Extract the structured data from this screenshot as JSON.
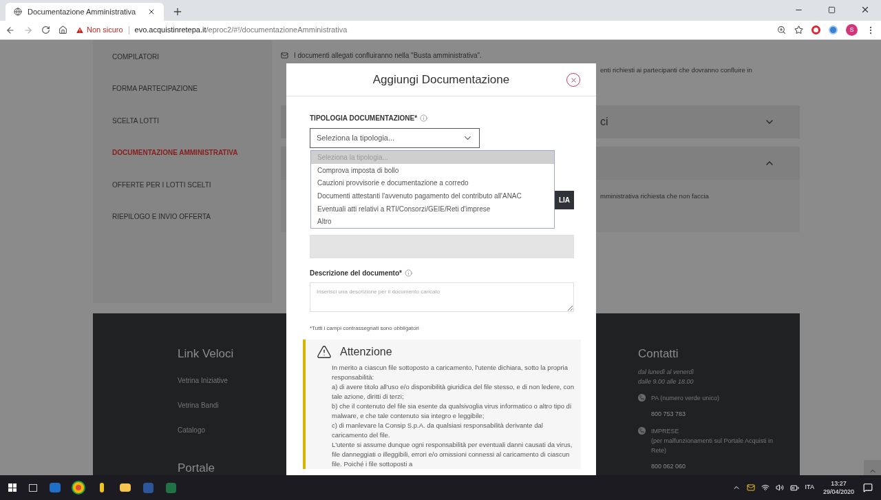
{
  "browser": {
    "tab_title": "Documentazione Amministrativa",
    "security": "Non sicuro",
    "url_domain": "evo.acquistinretepa.it",
    "url_path": "/eproc2/#!/documentazioneAmministrativa",
    "profile_initial": "S"
  },
  "sidebar": {
    "items": [
      {
        "label": "COMPILATORI",
        "selected": false
      },
      {
        "label": "FORMA PARTECIPAZIONE",
        "selected": false
      },
      {
        "label": "SCELTA LOTTI",
        "selected": false
      },
      {
        "label": "DOCUMENTAZIONE AMMINISTRATIVA",
        "selected": true
      },
      {
        "label": "OFFERTE PER I LOTTI SCELTI",
        "selected": false
      },
      {
        "label": "RIEPILOGO E INVIO OFFERTA",
        "selected": false
      }
    ]
  },
  "page": {
    "notice": "I documenti allegati confluiranno nella \"Busta amministrativa\".",
    "intro_fragment": "enti richiesti ai partecipanti che dovranno confluire in",
    "accordions": [
      {
        "title": "ci",
        "expanded": false
      },
      {
        "expanded": true,
        "body": "mministrativa richiesta che non faccia"
      }
    ]
  },
  "modal": {
    "title": "Aggiungi Documentazione",
    "type_field": {
      "label": "TIPOLOGIA DOCUMENTAZIONE*",
      "value": "Seleziona la tipologia...",
      "expanded": true,
      "options": [
        {
          "label": "Seleziona la tipologia...",
          "selected": true
        },
        {
          "label": "Comprova imposta di bollo",
          "selected": false
        },
        {
          "label": "Cauzioni provvisorie e documentazione a corredo",
          "selected": false
        },
        {
          "label": "Documenti attestanti l'avvenuto pagamento del contributo all'ANAC",
          "selected": false
        },
        {
          "label": "Eventuali atti relativi a RTI/Consorzi/GEIE/Reti d'imprese",
          "selected": false
        },
        {
          "label": "Altro",
          "selected": false
        }
      ]
    },
    "browse_button": "LIA",
    "description_field": {
      "label": "Descrizione del documento*",
      "placeholder": "Inserisci una descrizione per il documento caricato"
    },
    "required_note": "*Tutti i campi contrassegnati sono obbligatori",
    "warning": {
      "title": "Attenzione",
      "paragraphs": [
        "In merito a ciascun file sottoposto a caricamento, l'utente dichiara, sotto la propria responsabilità:",
        "a) di avere titolo all'uso e/o disponibilità giuridica del file stesso, e di non ledere, con tale azione, diritti di terzi;",
        "b) che il contenuto del file sia esente da qualsivoglia virus informatico o altro tipo di malware, e che tale contenuto sia integro e leggibile;",
        "c) di manlevare la Consip S.p.A. da qualsiasi responsabilità derivante dal caricamento del file.",
        "L'utente si assume dunque ogni responsabilità per eventuali danni causati da virus, file danneggiati o illeggibili, errori e/o omissioni connessi al caricamento di ciascun file. Poiché i file sottoposti a"
      ]
    }
  },
  "footer": {
    "links_title": "Link Veloci",
    "links": [
      "Vetrina Iniziative",
      "Vetrina Bandi",
      "Catalogo"
    ],
    "portal_title": "Portale",
    "contacts_title": "Contatti",
    "hours": [
      "dal lunedì al venerdì",
      "dalle 9.00 alle 18.00"
    ],
    "contacts": [
      {
        "label": "PA (numero verde unico)",
        "number": "800 753 783"
      },
      {
        "label": "IMPRESE",
        "note": "(per malfunzionamenti sul Portale Acquisti in Rete)",
        "number": "800 062 060"
      }
    ]
  },
  "taskbar": {
    "language": "ITA",
    "time": "13:27",
    "date": "29/04/2020"
  }
}
